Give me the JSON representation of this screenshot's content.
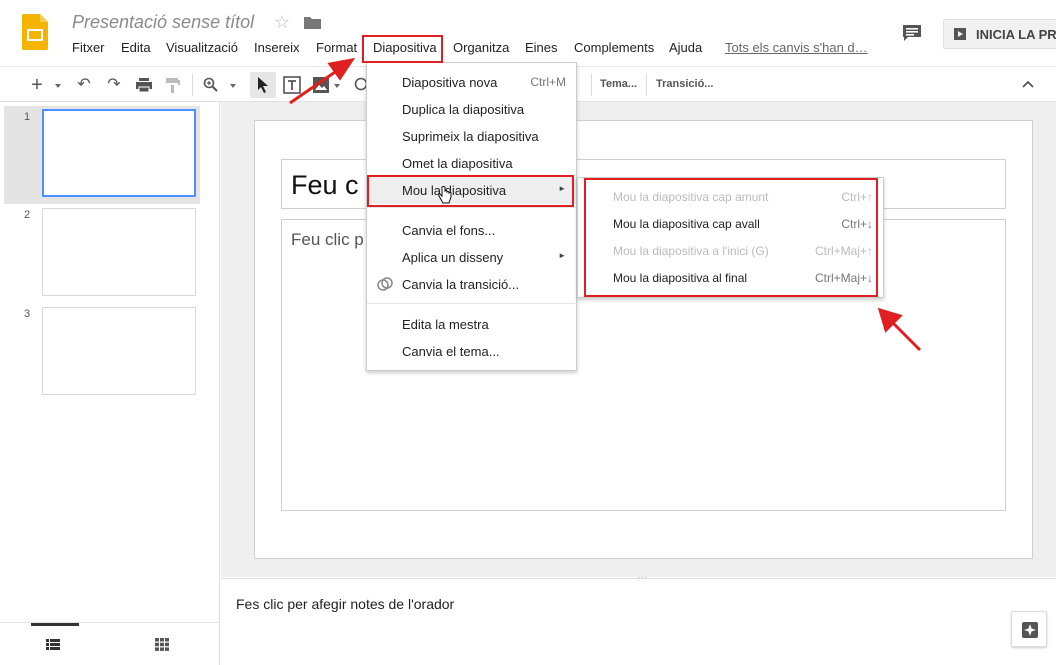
{
  "header": {
    "doc_title": "Presentació sense títol",
    "save_status": "Tots els canvis s'han d…",
    "present_label": "INICIA LA PR"
  },
  "menubar": [
    {
      "label": "Fitxer"
    },
    {
      "label": "Edita"
    },
    {
      "label": "Visualització"
    },
    {
      "label": "Insereix"
    },
    {
      "label": "Format"
    },
    {
      "label": "Diapositiva"
    },
    {
      "label": "Organitza"
    },
    {
      "label": "Eines"
    },
    {
      "label": "Complements"
    },
    {
      "label": "Ajuda"
    }
  ],
  "toolbar": {
    "theme_label": "Tema...",
    "transition_label": "Transició..."
  },
  "slides": [
    {
      "number": "1"
    },
    {
      "number": "2"
    },
    {
      "number": "3"
    }
  ],
  "slide": {
    "title_placeholder": "Feu c",
    "body_placeholder": "Feu clic p"
  },
  "notes": {
    "placeholder": "Fes clic per afegir notes de l'orador"
  },
  "slide_menu": {
    "items": [
      {
        "label": "Diapositiva nova",
        "shortcut": "Ctrl+M"
      },
      {
        "label": "Duplica la diapositiva",
        "shortcut": ""
      },
      {
        "label": "Suprimeix la diapositiva",
        "shortcut": ""
      },
      {
        "label": "Omet la diapositiva",
        "shortcut": ""
      },
      {
        "label": "Mou la diapositiva",
        "shortcut": ""
      },
      {
        "label": "Canvia el fons...",
        "shortcut": ""
      },
      {
        "label": "Aplica un disseny",
        "shortcut": ""
      },
      {
        "label": "Canvia la transició...",
        "shortcut": ""
      },
      {
        "label": "Edita la mestra",
        "shortcut": ""
      },
      {
        "label": "Canvia el tema...",
        "shortcut": ""
      }
    ]
  },
  "move_submenu": {
    "items": [
      {
        "label": "Mou la diapositiva cap amunt",
        "shortcut": "Ctrl+↑",
        "enabled": false
      },
      {
        "label": "Mou la diapositiva cap avall",
        "shortcut": "Ctrl+↓",
        "enabled": true
      },
      {
        "label": "Mou la diapositiva a l'inici (G)",
        "shortcut": "Ctrl+Maj+↑",
        "enabled": false
      },
      {
        "label": "Mou la diapositiva al final",
        "shortcut": "Ctrl+Maj+↓",
        "enabled": true
      }
    ]
  },
  "colors": {
    "accent": "#4d90fe",
    "logo": "#f4b400",
    "annotation": "#e02020"
  }
}
